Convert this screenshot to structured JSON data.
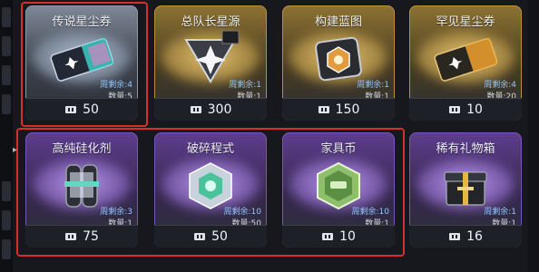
{
  "shop": {
    "items": [
      {
        "name": "传说星尘券",
        "weekly": "周剩余:4",
        "qty": "数量:5",
        "price": "50",
        "rarity": "legendary",
        "icon": "ticket-icon"
      },
      {
        "name": "总队长星源",
        "weekly": "周剩余:1",
        "qty": "数量:1",
        "price": "300",
        "rarity": "gold",
        "icon": "star-source-icon"
      },
      {
        "name": "构建蓝图",
        "weekly": "周剩余:1",
        "qty": "数量:1",
        "price": "150",
        "rarity": "gold",
        "icon": "blueprint-icon"
      },
      {
        "name": "罕见星尘券",
        "weekly": "周剩余:4",
        "qty": "数量:20",
        "price": "10",
        "rarity": "gold",
        "icon": "ticket-icon"
      },
      {
        "name": "高纯硅化剂",
        "weekly": "周剩余:3",
        "qty": "数量:1",
        "price": "75",
        "rarity": "purple",
        "icon": "canister-icon"
      },
      {
        "name": "破碎程式",
        "weekly": "周剩余:10",
        "qty": "数量:50",
        "price": "50",
        "rarity": "purple",
        "icon": "chip-icon"
      },
      {
        "name": "家具币",
        "weekly": "周剩余:10",
        "qty": "数量:1",
        "price": "10",
        "rarity": "purple",
        "icon": "furniture-coin-icon"
      },
      {
        "name": "稀有礼物箱",
        "weekly": "周剩余:1",
        "qty": "数量:1",
        "price": "16",
        "rarity": "purple",
        "icon": "gift-box-icon"
      }
    ]
  },
  "colors": {
    "gold": "#e7b63f",
    "purple": "#8b5fd0",
    "selection": "#d2302c",
    "weekly_text": "#8fc8ff"
  }
}
